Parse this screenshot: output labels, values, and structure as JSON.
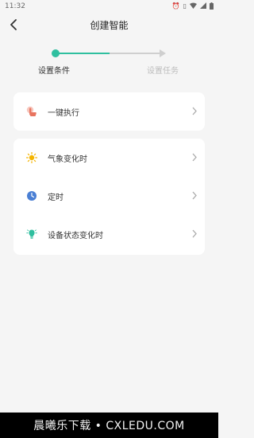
{
  "status_bar": {
    "time": "11:32",
    "icons": [
      "alarm-icon",
      "vibrate-icon",
      "wifi-icon",
      "signal-icon",
      "battery-icon"
    ]
  },
  "header": {
    "title": "创建智能",
    "back_icon": "chevron-left-icon"
  },
  "steps": {
    "items": [
      {
        "label": "设置条件",
        "state": "active"
      },
      {
        "label": "设置任务",
        "state": "inactive"
      }
    ],
    "accent_color": "#2fbf9f",
    "inactive_color": "#cfcfcf"
  },
  "cards": {
    "one_click": {
      "label": "一键执行",
      "icon": "tap-hand-icon"
    },
    "conditions": [
      {
        "label": "气象变化时",
        "icon": "sun-icon"
      },
      {
        "label": "定时",
        "icon": "clock-icon"
      },
      {
        "label": "设备状态变化时",
        "icon": "bulb-icon"
      }
    ]
  },
  "watermark": {
    "text": "晨曦乐下载 • CXLEDU.COM"
  }
}
